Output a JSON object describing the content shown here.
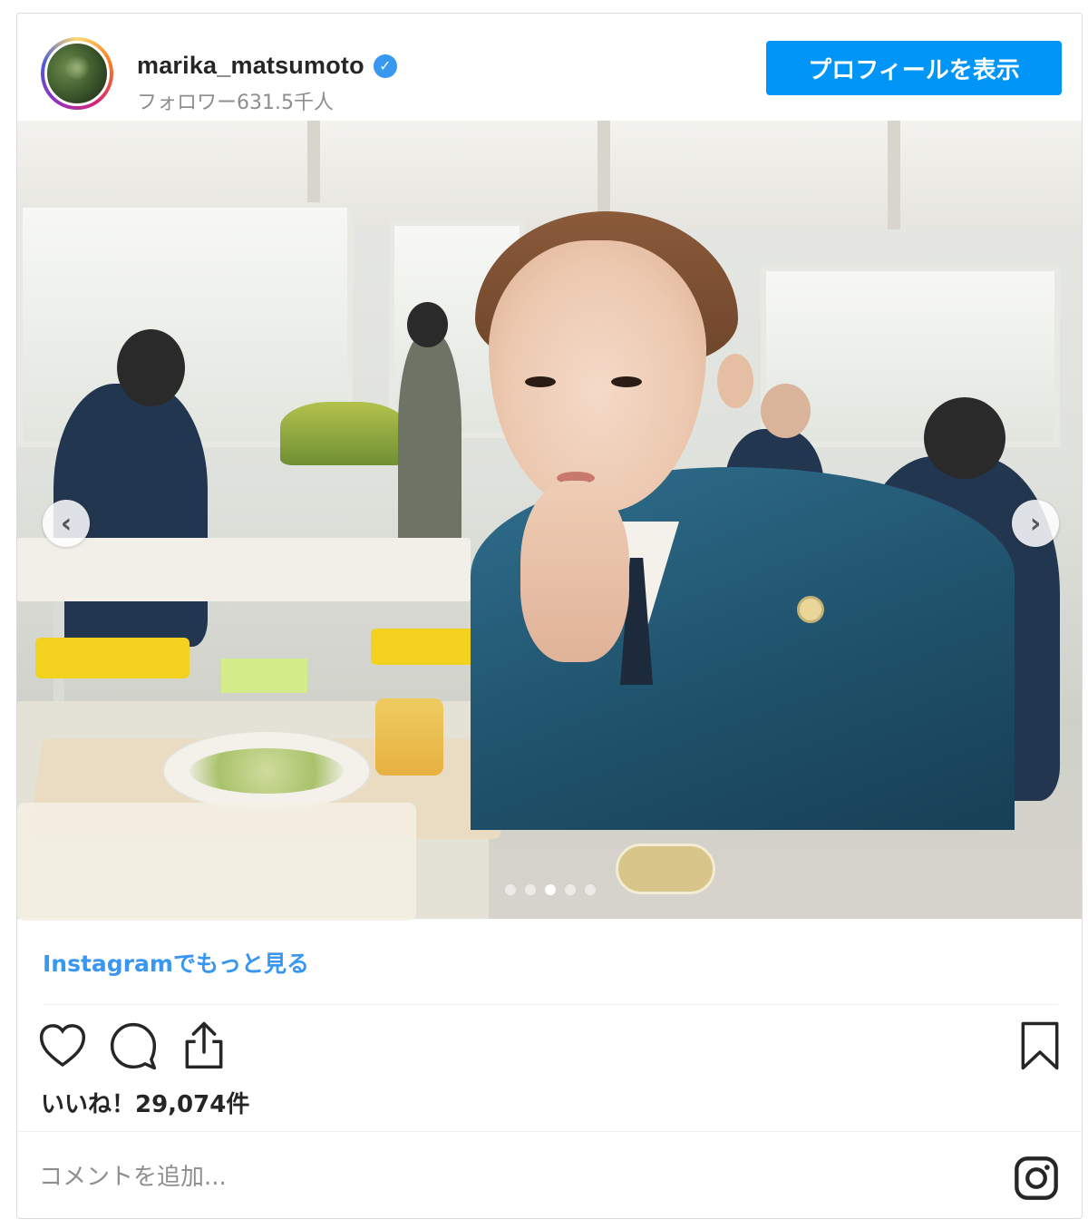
{
  "header": {
    "username": "marika_matsumoto",
    "verified_mark": "✓",
    "followers": "フォロワー631.5千人",
    "profile_button": "プロフィールを表示"
  },
  "photo": {
    "prev_arrow": "‹",
    "next_arrow": "›",
    "carousel_total": 5,
    "carousel_active": 3
  },
  "more_link": "Instagramでもっと見る",
  "actions": {
    "icons": [
      "heart-icon",
      "comment-icon",
      "share-icon",
      "bookmark-icon"
    ]
  },
  "likes": "いいね！29,074件",
  "comment": {
    "placeholder": "コメントを追加..."
  },
  "colors": {
    "accent": "#0095f6",
    "link": "#3897f0",
    "verified": "#3897f0"
  }
}
